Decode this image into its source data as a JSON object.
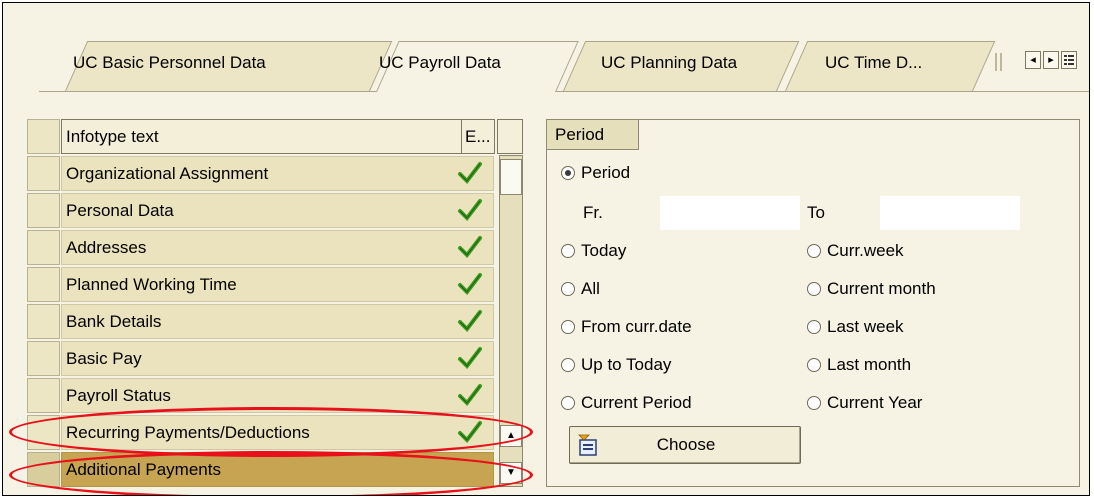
{
  "tabs": [
    {
      "label": "UC Basic Personnel Data",
      "active": false
    },
    {
      "label": "UC Payroll Data",
      "active": true
    },
    {
      "label": "UC Planning Data",
      "active": false
    },
    {
      "label": "UC Time D...",
      "active": false
    }
  ],
  "table": {
    "headers": {
      "text": "Infotype text",
      "e": "E..."
    },
    "rows": [
      {
        "text": "Organizational Assignment",
        "checked": true
      },
      {
        "text": "Personal Data",
        "checked": true
      },
      {
        "text": "Addresses",
        "checked": true
      },
      {
        "text": "Planned Working Time",
        "checked": true
      },
      {
        "text": "Bank Details",
        "checked": true
      },
      {
        "text": "Basic Pay",
        "checked": true
      },
      {
        "text": "Payroll Status",
        "checked": true
      },
      {
        "text": "Recurring Payments/Deductions",
        "checked": true
      },
      {
        "text": "Additional Payments",
        "checked": false
      }
    ]
  },
  "period": {
    "title": "Period",
    "period_label": "Period",
    "from_label": "Fr.",
    "to_label": "To",
    "from_value": "",
    "to_value": "",
    "options_left": [
      "Today",
      "All",
      "From curr.date",
      "Up to Today",
      "Current Period"
    ],
    "options_right": [
      "Curr.week",
      "Current month",
      "Last week",
      "Last month",
      "Current Year"
    ],
    "selected": "Period",
    "choose_label": "Choose"
  },
  "colors": {
    "background": "#f6f3e4",
    "selected_row": "#c6a451",
    "highlight": "#e8101a",
    "check": "#3c9a1e"
  }
}
